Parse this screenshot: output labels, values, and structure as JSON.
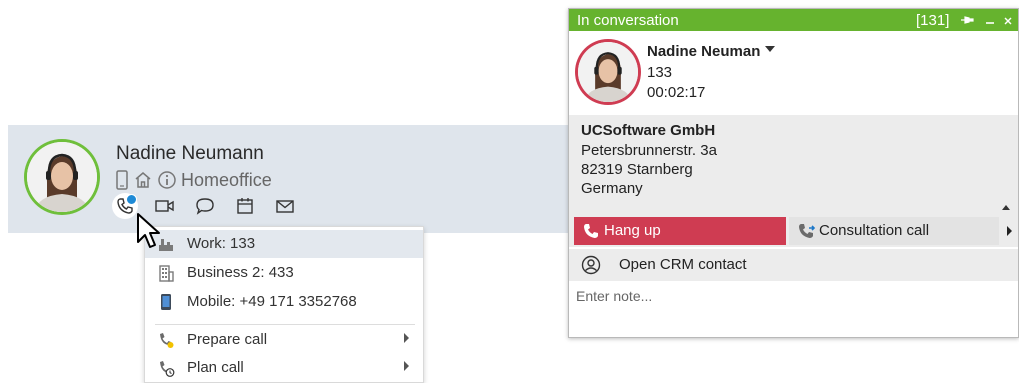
{
  "contact_card": {
    "name": "Nadine Neumann",
    "location": "Homeoffice",
    "presence_color": "#6fbf3b",
    "status_icons": [
      "mobile-icon",
      "home-icon",
      "info-icon"
    ],
    "actions": [
      "phone-icon",
      "video-icon",
      "chat-icon",
      "calendar-icon",
      "mail-icon"
    ]
  },
  "phone_menu": {
    "items": [
      {
        "icon": "work-phone-icon",
        "label": "Work: 133"
      },
      {
        "icon": "building-icon",
        "label": "Business 2: 433"
      },
      {
        "icon": "mobile-icon",
        "label": "Mobile: +49 171 3352768"
      },
      {
        "icon": "prepare-call-icon",
        "label": "Prepare call"
      },
      {
        "icon": "plan-call-icon",
        "label": "Plan call"
      }
    ]
  },
  "conversation": {
    "title": "In conversation",
    "extension_badge": "[131]",
    "header_color": "#66b32e",
    "contact_name": "Nadine Neuman",
    "extension": "133",
    "duration": "00:02:17",
    "company": {
      "name": "UCSoftware GmbH",
      "street": "Petersbrunnerstr. 3a",
      "city": "82319 Starnberg",
      "country": "Germany"
    },
    "hangup_label": "Hang up",
    "hangup_color": "#cf3c52",
    "consult_label": "Consultation call",
    "crm_label": "Open CRM contact",
    "note_placeholder": "Enter note..."
  }
}
